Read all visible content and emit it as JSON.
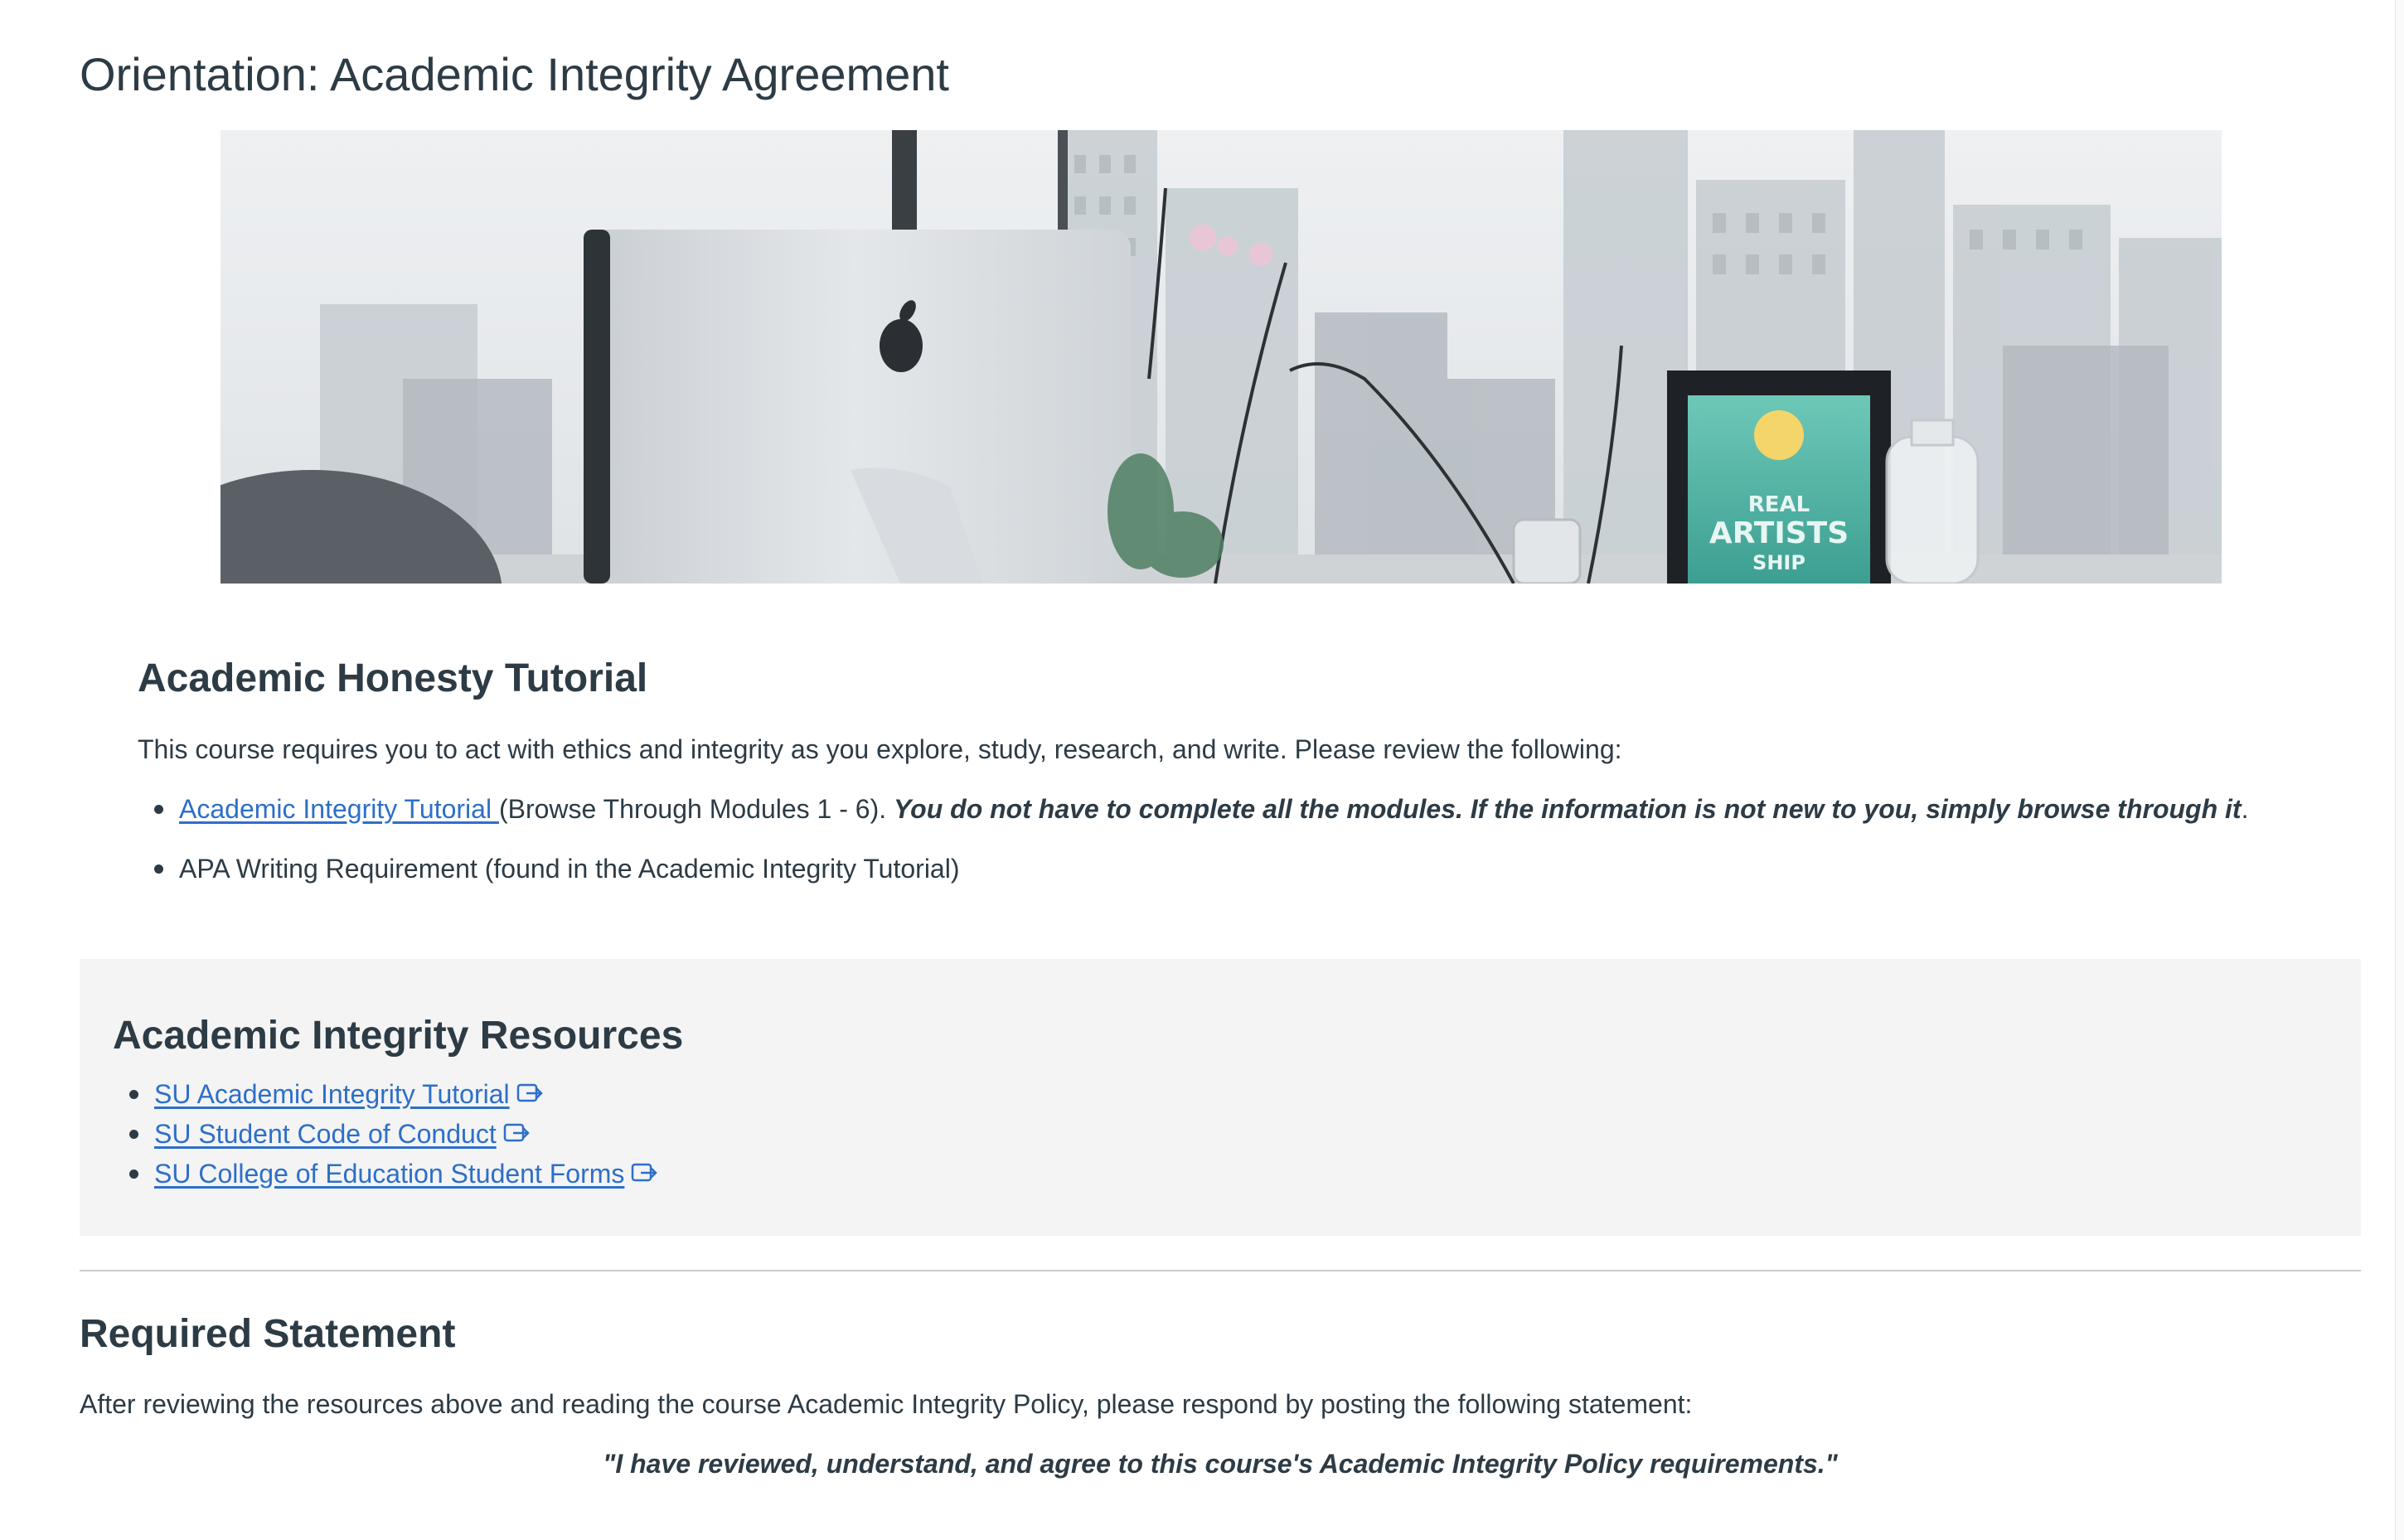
{
  "page": {
    "title": "Orientation: Academic Integrity Agreement"
  },
  "banner": {
    "frame_text_lines": [
      "REAL",
      "ARTISTS",
      "SHIP"
    ]
  },
  "tutorial_section": {
    "heading": "Academic Honesty Tutorial",
    "intro": "This course requires you to act with ethics and integrity as you explore, study, research, and write. Please review the following:",
    "items": [
      {
        "link_label": "Academic Integrity Tutorial ",
        "plain_text": "(Browse Through Modules 1 - 6). ",
        "emphasis_text": "You do not have to complete all the modules. If the information is not new to you, simply browse through it",
        "trailing_text": "."
      },
      {
        "plain_text": "APA Writing Requirement (found in the Academic Integrity Tutorial)"
      }
    ]
  },
  "resources_section": {
    "heading": "Academic Integrity Resources",
    "links": [
      {
        "label": "SU Academic Integrity Tutorial",
        "icon": "external-link-icon"
      },
      {
        "label": "SU Student Code of Conduct",
        "icon": "external-link-icon"
      },
      {
        "label": "SU College of Education Student Forms",
        "icon": "external-link-icon"
      }
    ]
  },
  "statement_section": {
    "heading": "Required Statement",
    "instructions": "After reviewing the resources above and reading the course Academic Integrity Policy, please respond by posting the following statement:",
    "quote": "\"I have reviewed, understand, and agree to this course's Academic Integrity Policy requirements.\""
  },
  "colors": {
    "text": "#2d3b45",
    "link": "#2d6fc8",
    "resources_background": "#f4f4f5",
    "divider": "#c7cdd1"
  }
}
